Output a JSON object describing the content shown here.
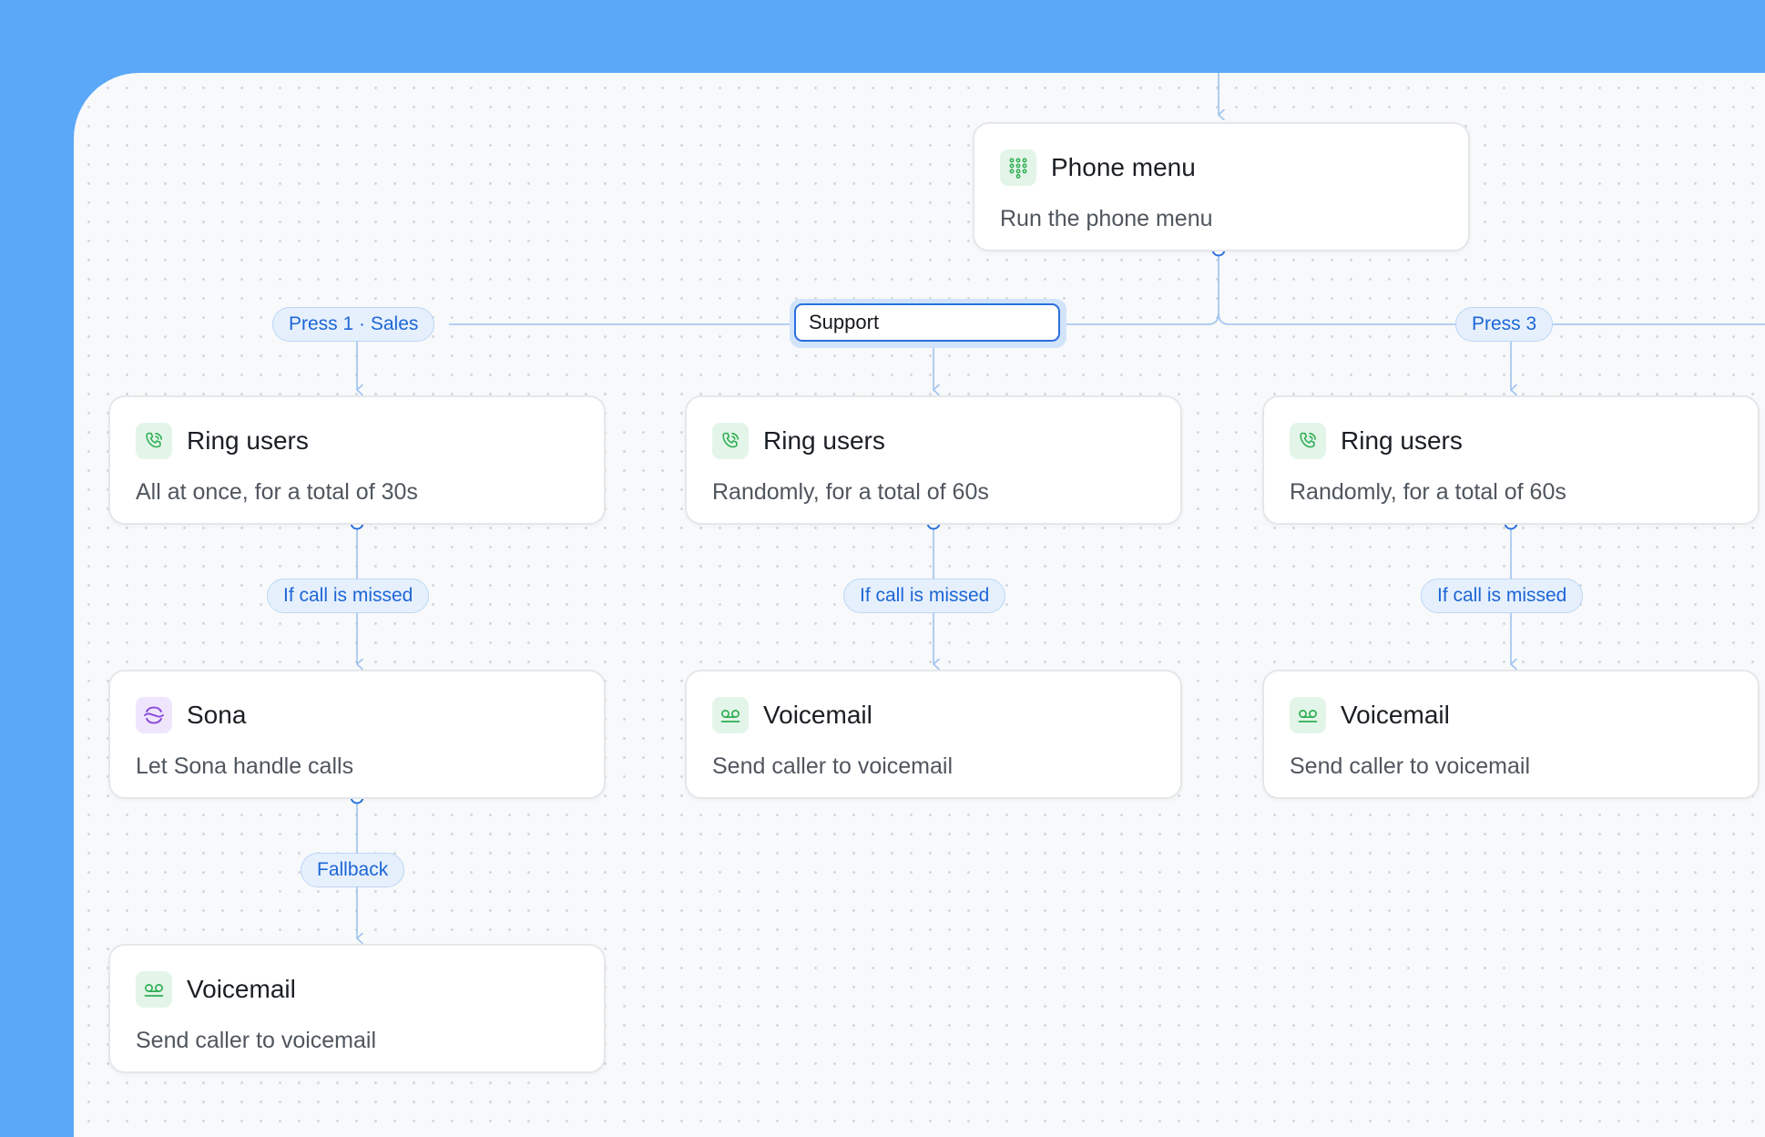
{
  "flow": {
    "phone_menu": {
      "title": "Phone menu",
      "subtitle": "Run the phone menu",
      "icon": "dialpad-icon"
    },
    "branches": {
      "press1": {
        "label": "Press 1 · Sales",
        "ring": {
          "title": "Ring users",
          "subtitle": "All at once, for a total of 30s",
          "icon": "phone-ring-icon"
        },
        "missed_label": "If call is missed",
        "sona": {
          "title": "Sona",
          "subtitle": "Let Sona handle calls",
          "icon": "sona-logo-icon"
        },
        "fallback_label": "Fallback",
        "voicemail": {
          "title": "Voicemail",
          "subtitle": "Send caller to voicemail",
          "icon": "voicemail-icon"
        }
      },
      "press2": {
        "label_input_value": "Support",
        "ring": {
          "title": "Ring users",
          "subtitle": "Randomly, for a total of 60s",
          "icon": "phone-ring-icon"
        },
        "missed_label": "If call is missed",
        "voicemail": {
          "title": "Voicemail",
          "subtitle": "Send caller to voicemail",
          "icon": "voicemail-icon"
        }
      },
      "press3": {
        "label": "Press 3",
        "ring": {
          "title": "Ring users",
          "subtitle": "Randomly, for a total of 60s",
          "icon": "phone-ring-icon"
        },
        "missed_label": "If call is missed",
        "voicemail": {
          "title": "Voicemail",
          "subtitle": "Send caller to voicemail",
          "icon": "voicemail-icon"
        }
      }
    }
  },
  "colors": {
    "background": "#5ba8f8",
    "canvas": "#f8f9fa",
    "connector": "#9cc3f1",
    "pill_text": "#1d66d6",
    "accent_green": "#2fae55",
    "accent_purple": "#8b4ddb"
  }
}
